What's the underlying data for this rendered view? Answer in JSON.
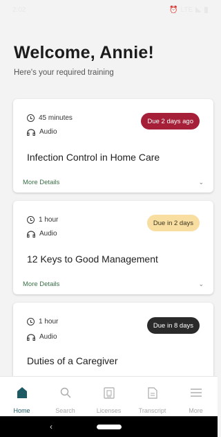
{
  "status": {
    "time": "2:02",
    "network": "LTE"
  },
  "header": {
    "title": "Welcome, Annie!",
    "subtitle": "Here's your required training"
  },
  "colors": {
    "overdue": "#a51f38",
    "soon": "#f8dea0",
    "later": "#2a2a2a",
    "accent": "#1d5a63",
    "link": "#3a6f47"
  },
  "courses": [
    {
      "duration": "45 minutes",
      "format": "Audio",
      "due": "Due 2 days ago",
      "title": "Infection Control in Home Care",
      "details": "More Details"
    },
    {
      "duration": "1 hour",
      "format": "Audio",
      "due": "Due in 2 days",
      "title": "12 Keys to Good Management",
      "details": "More Details"
    },
    {
      "duration": "1 hour",
      "format": "Audio",
      "due": "Due in 8 days",
      "title": "Duties of a Caregiver"
    }
  ],
  "tabs": [
    {
      "label": "Home",
      "icon": "home-icon",
      "active": true
    },
    {
      "label": "Search",
      "icon": "search-icon"
    },
    {
      "label": "Licenses",
      "icon": "license-icon"
    },
    {
      "label": "Transcript",
      "icon": "transcript-icon"
    },
    {
      "label": "More",
      "icon": "menu-icon"
    }
  ]
}
